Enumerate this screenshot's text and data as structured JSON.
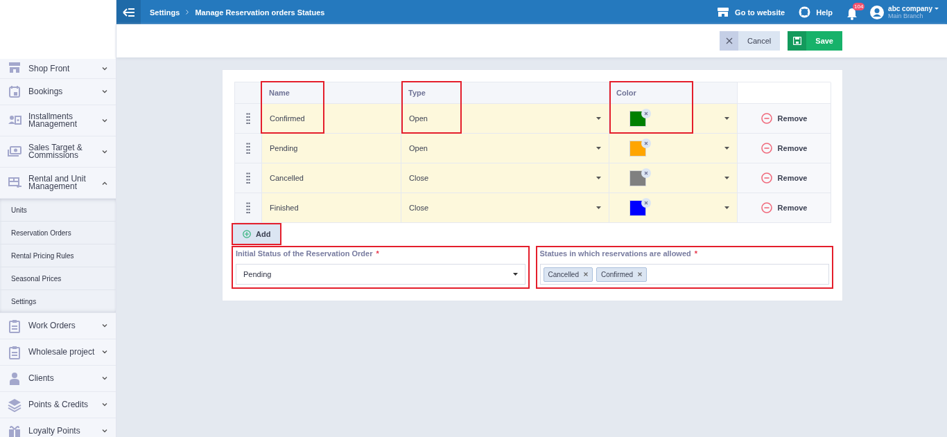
{
  "topbar": {
    "breadcrumbs": [
      "Settings",
      "Manage Reservation orders Statues"
    ],
    "website_link": "Go to website",
    "help_link": "Help",
    "notification_count": "104",
    "user_name": "abc company",
    "branch": "Main Branch"
  },
  "actions": {
    "cancel": "Cancel",
    "save": "Save"
  },
  "sidebar": {
    "items": [
      {
        "label": "Shop Front",
        "expanded": false
      },
      {
        "label": "Bookings",
        "expanded": false
      },
      {
        "label": "Installments Management",
        "expanded": false
      },
      {
        "label": "Sales Target & Commissions",
        "expanded": false
      },
      {
        "label": "Rental and Unit Management",
        "expanded": true,
        "children": [
          {
            "label": "Units"
          },
          {
            "label": "Reservation Orders"
          },
          {
            "label": "Rental Pricing Rules"
          },
          {
            "label": "Seasonal Prices"
          },
          {
            "label": "Settings"
          }
        ]
      },
      {
        "label": "Work Orders",
        "expanded": false
      },
      {
        "label": "Wholesale project",
        "expanded": false
      },
      {
        "label": "Clients",
        "expanded": false
      },
      {
        "label": "Points & Credits",
        "expanded": false
      },
      {
        "label": "Loyalty Points",
        "expanded": false
      }
    ]
  },
  "table": {
    "columns": [
      {
        "label": "Name",
        "highlighted": true
      },
      {
        "label": "Type",
        "highlighted": true
      },
      {
        "label": "Color",
        "highlighted": true
      }
    ],
    "rows": [
      {
        "name": "Confirmed",
        "type": "Open",
        "color": "#008000",
        "remove": "Remove"
      },
      {
        "name": "Pending",
        "type": "Open",
        "color": "#ffa500",
        "remove": "Remove"
      },
      {
        "name": "Cancelled",
        "type": "Close",
        "color": "#808080",
        "remove": "Remove"
      },
      {
        "name": "Finished",
        "type": "Close",
        "color": "#0000ff",
        "remove": "Remove"
      }
    ],
    "add_button": {
      "label": "Add",
      "highlighted": true
    }
  },
  "fields": [
    {
      "kind": "select",
      "label": "Initial Status of the Reservation Order",
      "required_mark": "*",
      "value": "Pending",
      "highlighted": true
    },
    {
      "kind": "tags",
      "label": "Statues in which reservations are allowed",
      "required_mark": "*",
      "tags": [
        "Cancelled",
        "Confirmed"
      ],
      "highlighted": true
    }
  ]
}
